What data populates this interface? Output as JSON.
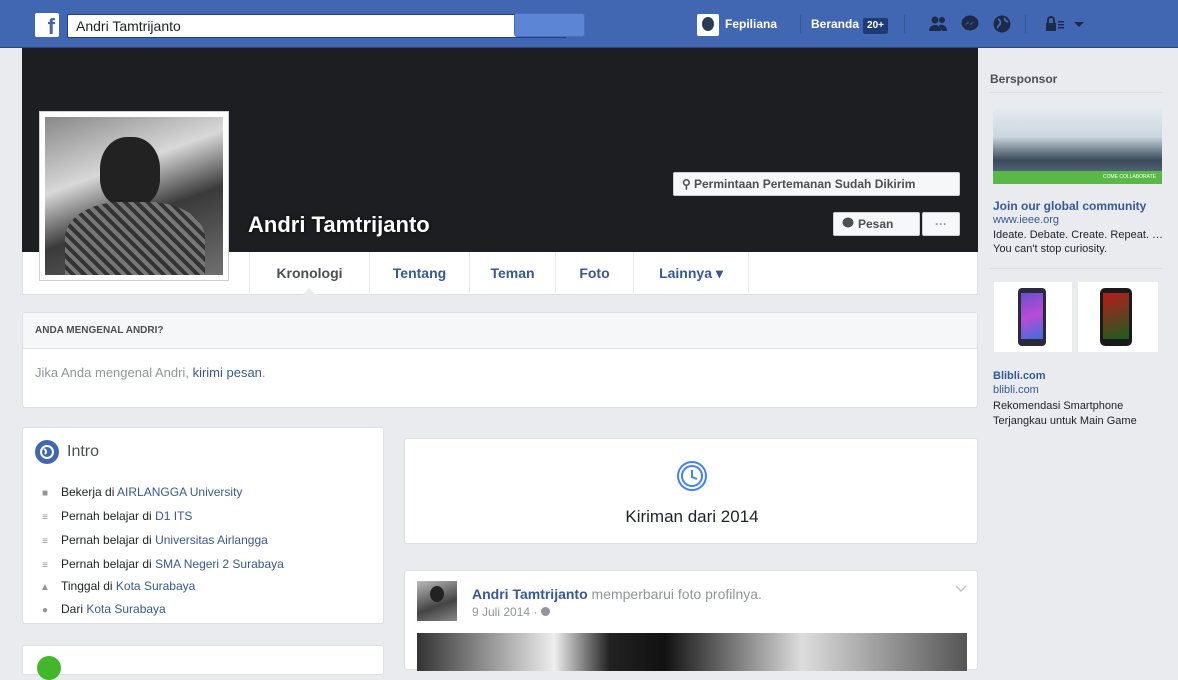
{
  "topbar": {
    "search_value": "Andri Tamtrijanto",
    "user_name": "Fepiliana",
    "home_label": "Beranda",
    "home_badge": "20+"
  },
  "profile": {
    "name": "Andri Tamtrijanto",
    "friend_request_label": "Permintaan Pertemanan Sudah Dikirim",
    "message_label": "Pesan",
    "more_label": "···"
  },
  "tabs": [
    {
      "label": "Kronologi"
    },
    {
      "label": "Tentang"
    },
    {
      "label": "Teman"
    },
    {
      "label": "Foto"
    },
    {
      "label": "Lainnya ▾"
    }
  ],
  "know": {
    "heading": "ANDA MENGENAL ANDRI?",
    "text": "Jika Anda mengenal Andri, ",
    "link": "kirimi pesan",
    "period": "."
  },
  "intro": {
    "title": "Intro",
    "items": [
      {
        "prefix": "Bekerja di ",
        "link": "AIRLANGGA University",
        "icon": "briefcase-icon"
      },
      {
        "prefix": "Pernah belajar di ",
        "link": "D1 ITS",
        "icon": "graduation-cap-icon"
      },
      {
        "prefix": "Pernah belajar di ",
        "link": "Universitas Airlangga",
        "icon": "graduation-cap-icon"
      },
      {
        "prefix": "Pernah belajar di ",
        "link": "SMA Negeri 2 Surabaya",
        "icon": "graduation-cap-icon"
      },
      {
        "prefix": "Tinggal di ",
        "link": "Kota Surabaya",
        "icon": "home-icon"
      },
      {
        "prefix": "Dari ",
        "link": "Kota Surabaya",
        "icon": "location-pin-icon"
      }
    ]
  },
  "posts_header": {
    "label": "Kiriman dari 2014"
  },
  "post": {
    "author": "Andri Tamtrijanto",
    "action": " memperbarui foto profilnya.",
    "date": "9 Juli 2014 · "
  },
  "sidebar": {
    "sponsored_label": "Bersponsor",
    "ad1": {
      "title": "Join our global community",
      "url": "www.ieee.org",
      "text": "Ideate. Debate. Create. Repeat. … You can't stop curiosity.",
      "banner_text": "COME COLLABORATE"
    },
    "ad2": {
      "title": "Blibli.com",
      "url": "blibli.com",
      "text": "Rekomendasi Smartphone Terjangkau untuk Main Game"
    }
  },
  "colors": {
    "brand": "#4267b2",
    "link": "#365899",
    "background": "#e9ebee"
  }
}
